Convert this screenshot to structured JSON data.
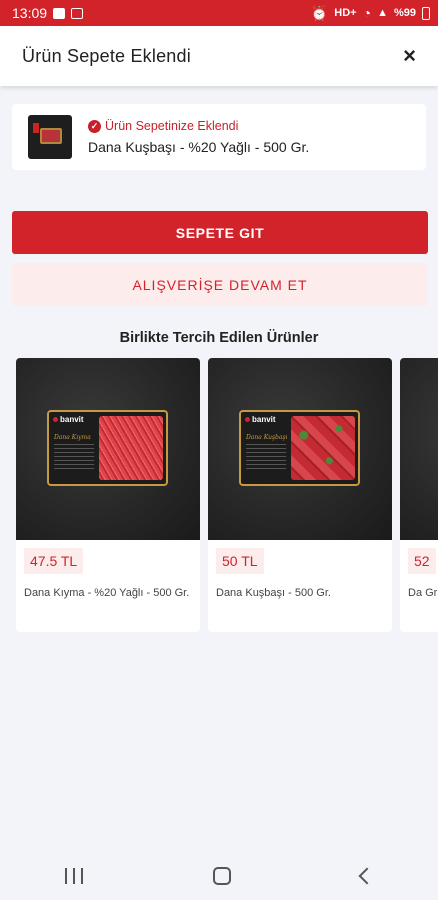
{
  "status_bar": {
    "time": "13:09",
    "network": "HD+",
    "battery": "%99"
  },
  "header": {
    "title": "Ürün Sepete Eklendi",
    "close_label": "×"
  },
  "added_item": {
    "status": "Ürün Sepetinize Eklendi",
    "product_name": "Dana Kuşbaşı - %20 Yağlı - 500 Gr."
  },
  "actions": {
    "go_to_cart": "SEPETE GIT",
    "continue_shopping": "ALIŞVERİŞE DEVAM ET"
  },
  "recommendations": {
    "title": "Birlikte Tercih Edilen Ürünler",
    "items": [
      {
        "price": "47.5 TL",
        "name": "Dana Kıyma - %20 Yağlı - 500 Gr.",
        "tray_label": "Dana Kıyma"
      },
      {
        "price": "50 TL",
        "name": "Dana Kuşbaşı - 500 Gr.",
        "tray_label": "Dana Kuşbaşı"
      },
      {
        "price": "52",
        "name": "Da Gr"
      }
    ],
    "brand": "banvit"
  },
  "colors": {
    "accent": "#d3232a",
    "accent_light": "#fdecec",
    "background": "#f2f4f9"
  }
}
